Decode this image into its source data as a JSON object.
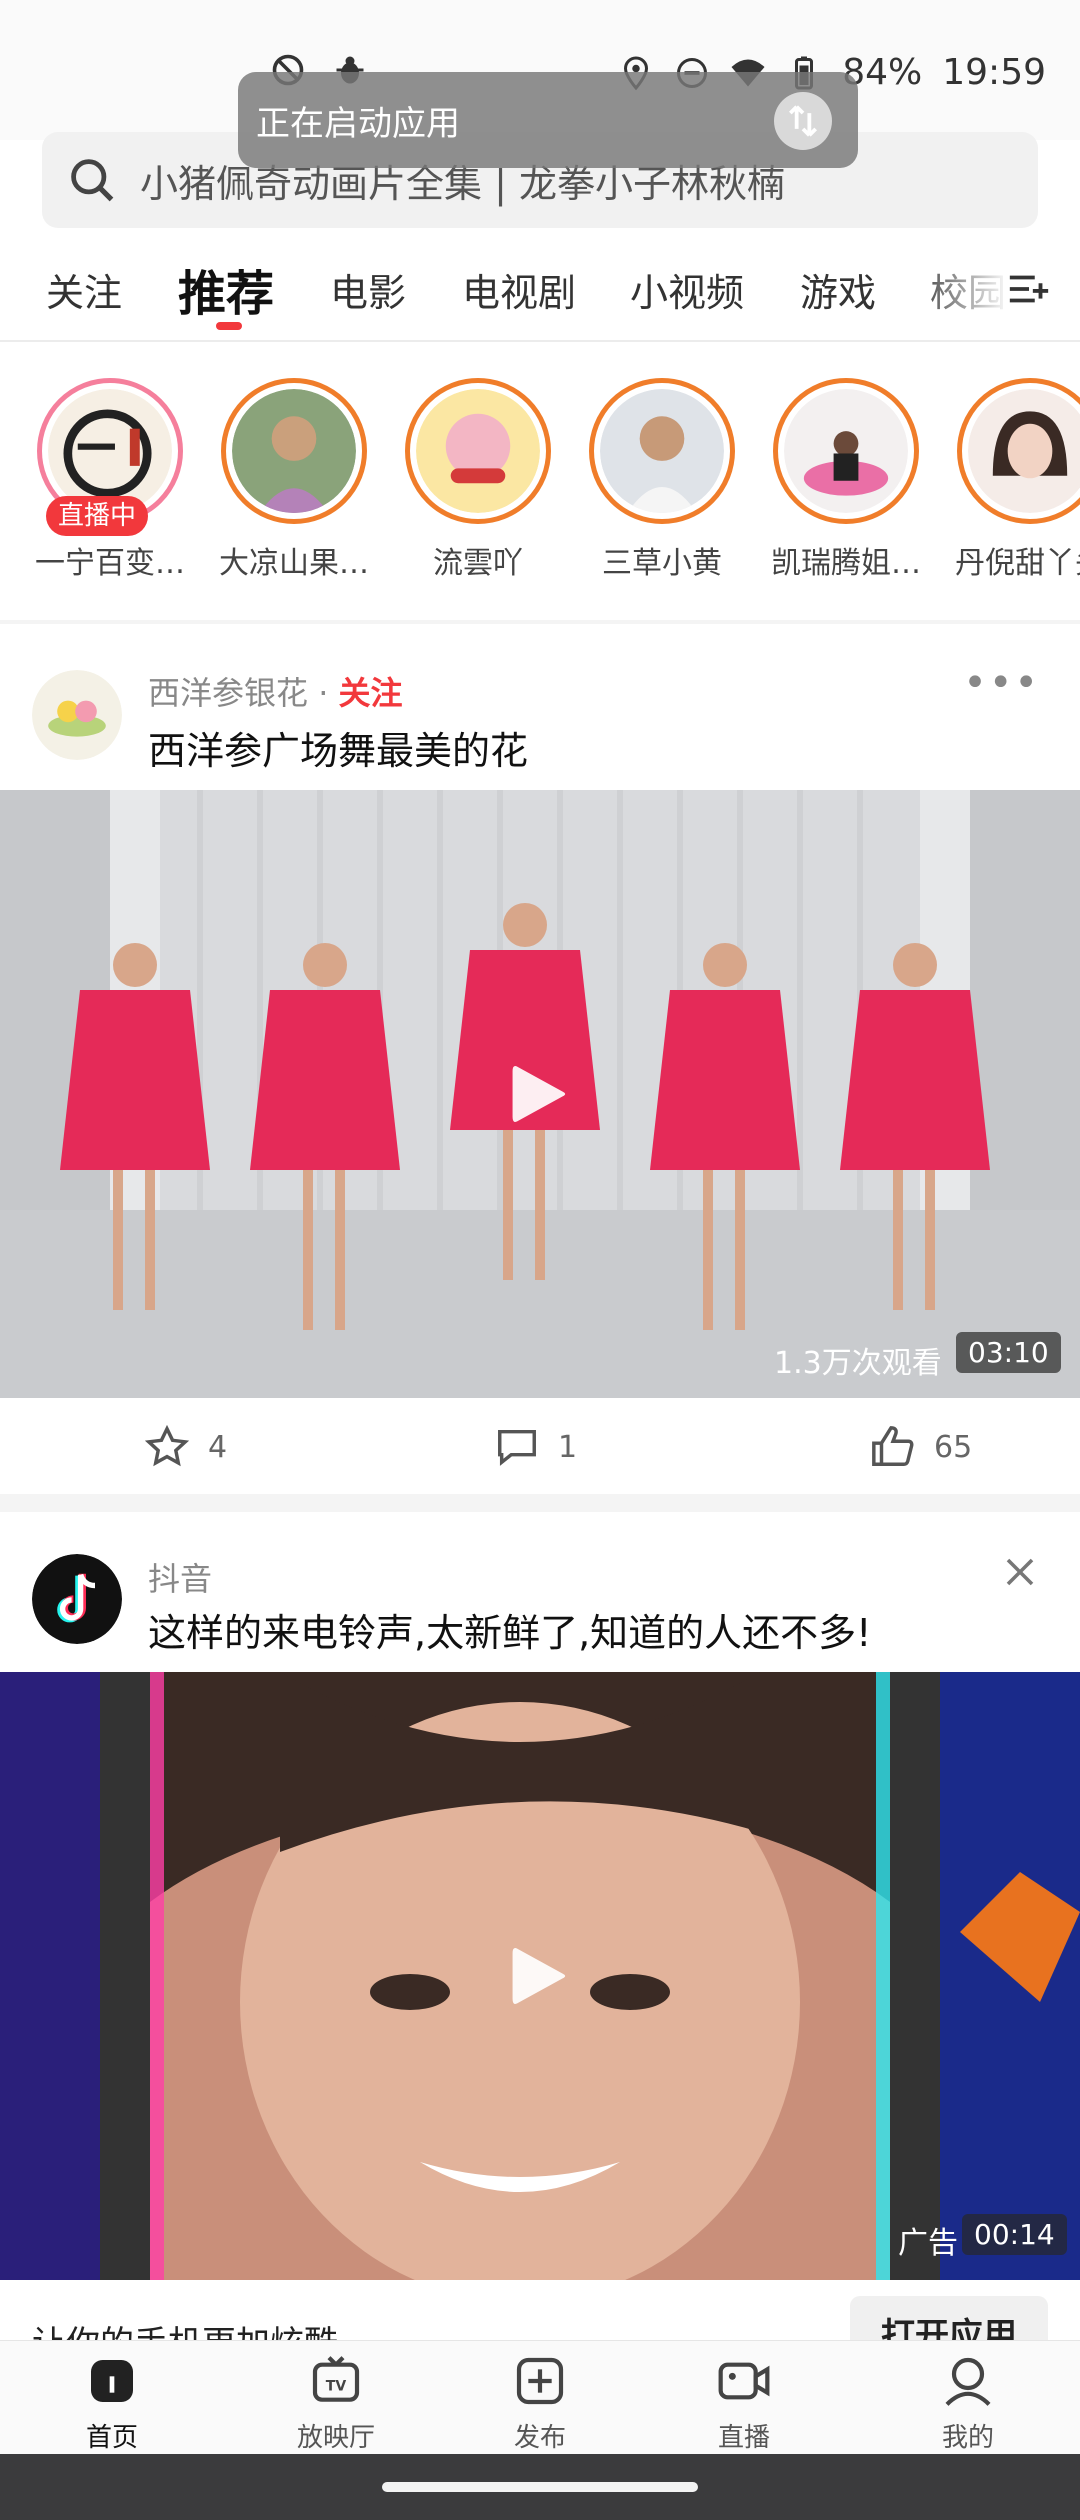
{
  "status_bar": {
    "battery": "84%",
    "time": "19:59"
  },
  "toast": {
    "text": "正在启动应用"
  },
  "search": {
    "placeholder": "小猪佩奇动画片全集 | 龙拳小子林秋楠"
  },
  "tabs": [
    {
      "label": "关注"
    },
    {
      "label": "推荐"
    },
    {
      "label": "电影"
    },
    {
      "label": "电视剧"
    },
    {
      "label": "小视频"
    },
    {
      "label": "游戏"
    },
    {
      "label": "校园"
    }
  ],
  "stories": [
    {
      "name": "一宁百变…",
      "live_label": "直播中"
    },
    {
      "name": "大凉山果…"
    },
    {
      "name": "流雲吖"
    },
    {
      "name": "三草小黄"
    },
    {
      "name": "凯瑞腾姐…"
    },
    {
      "name": "丹倪甜丫头"
    }
  ],
  "post1": {
    "author": "西洋参银花",
    "follow": "关注",
    "dot": " · ",
    "title": "西洋参广场舞最美的花",
    "views": "1.3万次观看",
    "duration": "03:10",
    "favorites": "4",
    "comments": "1",
    "likes": "65"
  },
  "post2": {
    "author": "抖音",
    "title": "这样的来电铃声,太新鲜了,知道的人还不多!",
    "ad_label": "广告",
    "duration": "00:14",
    "bottom_text": "让你的手机更加炫酷",
    "open_button": "打开应用"
  },
  "bottom_nav": [
    {
      "label": "首页"
    },
    {
      "label": "放映厅"
    },
    {
      "label": "发布"
    },
    {
      "label": "直播"
    },
    {
      "label": "我的"
    }
  ],
  "colors": {
    "accent": "#f2383c",
    "story_ring": "#f07d2a",
    "live_ring": "#f57f9c"
  }
}
